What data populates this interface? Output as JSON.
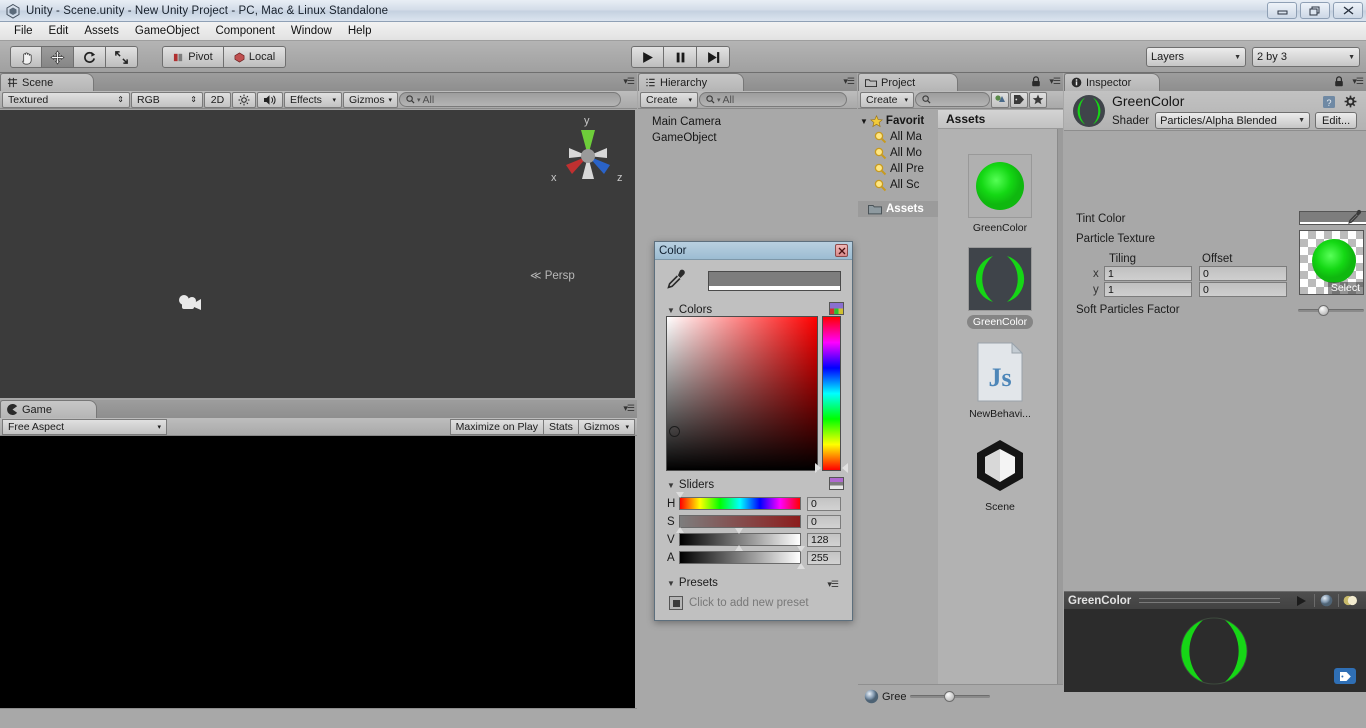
{
  "window": {
    "title": "Unity - Scene.unity - New Unity Project - PC, Mac & Linux Standalone",
    "minimize": "–",
    "restore": "❐",
    "close": "✕"
  },
  "menu": {
    "items": [
      "File",
      "Edit",
      "Assets",
      "GameObject",
      "Component",
      "Window",
      "Help"
    ]
  },
  "toolbar": {
    "tools": [
      {
        "name": "hand-tool",
        "glyph": "✋",
        "active": false
      },
      {
        "name": "move-tool",
        "glyph": "✥",
        "active": true
      },
      {
        "name": "rotate-tool",
        "glyph": "⟳",
        "active": false
      },
      {
        "name": "scale-tool",
        "glyph": "⤢",
        "active": false
      }
    ],
    "pivot_label": "Pivot",
    "space_label": "Local",
    "play_label": "▶",
    "pause_label": "❚❚",
    "step_label": "▶❙",
    "layers_label": "Layers",
    "layout_label": "2 by 3"
  },
  "scene_panel": {
    "tab_label": "Scene",
    "draw_mode": "Textured",
    "color_mode": "RGB",
    "two_d": "2D",
    "lighting_icon": "☀",
    "audio_icon": "🔊",
    "effects_label": "Effects",
    "gizmos_label": "Gizmos",
    "search_placeholder": "All",
    "axis_x": "x",
    "axis_y": "y",
    "axis_z": "z",
    "persp_label": "Persp"
  },
  "game_panel": {
    "tab_label": "Game",
    "aspect": "Free Aspect",
    "maximize_label": "Maximize on Play",
    "stats_label": "Stats",
    "gizmos_label": "Gizmos"
  },
  "hierarchy_panel": {
    "tab_label": "Hierarchy",
    "create_label": "Create",
    "search_placeholder": "All",
    "items": [
      "Main Camera",
      "GameObject"
    ]
  },
  "project_panel": {
    "tab_label": "Project",
    "create_label": "Create",
    "search_placeholder": "",
    "favorites_label": "Favorit",
    "favorites": [
      "All Ma",
      "All Mo",
      "All Pre",
      "All Sc"
    ],
    "assets_tree_label": "Assets",
    "breadcrumb": "Assets",
    "assets": [
      {
        "label": "GreenColor",
        "type": "material-sphere",
        "selected": false
      },
      {
        "label": "GreenColor",
        "type": "material-preview",
        "selected": true
      },
      {
        "label": "NewBehavi...",
        "type": "js-script",
        "selected": false
      },
      {
        "label": "Scene",
        "type": "unity-scene",
        "selected": false
      }
    ],
    "status_item": "Gree"
  },
  "inspector_panel": {
    "tab_label": "Inspector",
    "object_name": "GreenColor",
    "shader_label": "Shader",
    "shader_value": "Particles/Alpha Blended",
    "edit_label": "Edit...",
    "tint_color_label": "Tint Color",
    "particle_texture_label": "Particle Texture",
    "tiling_label": "Tiling",
    "offset_label": "Offset",
    "rows": [
      {
        "axis": "x",
        "tiling": "1",
        "offset": "0"
      },
      {
        "axis": "y",
        "tiling": "1",
        "offset": "0"
      }
    ],
    "select_label": "Select",
    "soft_particles_label": "Soft Particles Factor",
    "soft_particles_value": 0.62,
    "preview_title": "GreenColor"
  },
  "color_window": {
    "title": "Color",
    "close_label": "✕",
    "eyedropper_icon": "eyedropper-icon",
    "current_color": "#7d7d7d",
    "colors_label": "Colors",
    "sliders_label": "Sliders",
    "presets_label": "Presets",
    "preset_hint": "Click to add new preset",
    "sliders": [
      {
        "name": "H",
        "value": "0"
      },
      {
        "name": "S",
        "value": "0"
      },
      {
        "name": "V",
        "value": "128"
      },
      {
        "name": "A",
        "value": "255"
      }
    ]
  },
  "colors": {
    "accent_green": "#18d418",
    "panel_bg": "#a8a8a8",
    "scene_bg": "#3b3b3b",
    "title_blue": "#9cbcd2"
  }
}
